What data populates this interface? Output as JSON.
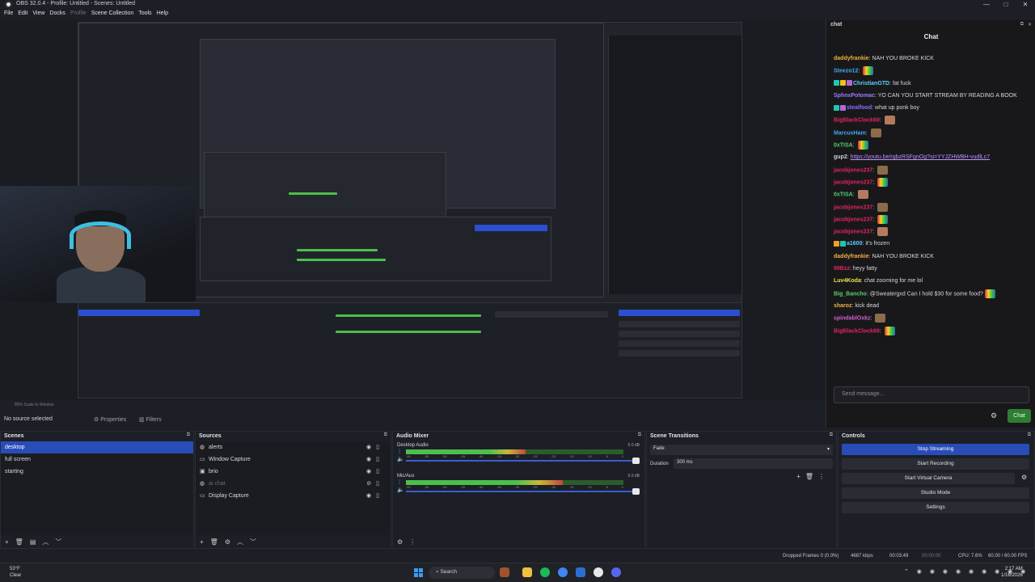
{
  "window": {
    "title": "OBS 32.0.4 - Profile: Untitled - Scenes: Untitled",
    "minimize": "—",
    "maximize": "□",
    "close": "✕"
  },
  "menu": [
    "File",
    "Edit",
    "View",
    "Docks",
    "Profile",
    "Scene Collection",
    "Tools",
    "Help"
  ],
  "preview_status": "85%     Scale to Window",
  "chat": {
    "dock_title": "chat",
    "header": "Chat",
    "input_placeholder": "Send message...",
    "send_label": "Chat",
    "messages": [
      {
        "user": "daddyfrankie",
        "text": "NAH YOU BROKE KICK",
        "color": "#f0b040"
      },
      {
        "user": "Steezo12",
        "text": "",
        "color": "#3fa9f5",
        "emote": true
      },
      {
        "user": "ChristianGTD",
        "text": "fat fuck",
        "color": "#5ad0ff",
        "badges": [
          "#1fc7b3",
          "#f0c020",
          "#b06ad8"
        ]
      },
      {
        "user": "SphnxPotomac",
        "text": "YO CAN YOU START STREAM BY READING A BOOK",
        "color": "#9b7bff"
      },
      {
        "user": "stealfood",
        "text": "what up ponk boy",
        "color": "#8f6cff",
        "badges": [
          "#1fc7b3",
          "#b06ad8"
        ]
      },
      {
        "user": "BigBlackClock69",
        "text": "",
        "color": "#e0245e",
        "emote": true
      },
      {
        "user": "MarcusHam",
        "text": "",
        "color": "#3fa9f5",
        "emote": true
      },
      {
        "user": "0xTISA",
        "text": "",
        "color": "#53d16f",
        "emote": true
      },
      {
        "user": "gup2",
        "text": "",
        "link": "https://youtu.be/rgbzRSFgnOg?si=YYJZHWBH-vudlLc7",
        "color": "#d0d0d6"
      },
      {
        "user": "jacobjones237",
        "text": "",
        "color": "#e0245e",
        "emote": true
      },
      {
        "user": "jacobjones237",
        "text": "",
        "color": "#e0245e",
        "emote": true
      },
      {
        "user": "0xTISA",
        "text": "",
        "color": "#53d16f",
        "emote": true
      },
      {
        "user": "jacobjones237",
        "text": "",
        "color": "#e0245e",
        "emote": true
      },
      {
        "user": "jacobjones237",
        "text": "",
        "color": "#e0245e",
        "emote": true
      },
      {
        "user": "jacobjones237",
        "text": "",
        "color": "#e0245e",
        "emote": true
      },
      {
        "user": "a1600",
        "text": "it's frozen",
        "color": "#5ad0ff",
        "badges": [
          "#f0a020",
          "#1fc7b3"
        ]
      },
      {
        "user": "daddyfrankie",
        "text": "NAH YOU BROKE KICK",
        "color": "#f0b040"
      },
      {
        "user": "99Bzz",
        "text": "heyy fatty",
        "color": "#e0245e"
      },
      {
        "user": "Luv4Koda",
        "text": "chat zooming for me lol",
        "color": "#f0e040"
      },
      {
        "user": "Big_Bancho",
        "text": "@Sweatergxd Can I hold $30 for some food?",
        "color": "#53d16f",
        "emote": true
      },
      {
        "user": "sharoz",
        "text": "kick dead",
        "color": "#f0b040"
      },
      {
        "user": "spindablOxkz",
        "text": "",
        "color": "#d05fd0",
        "emote": true
      },
      {
        "user": "BigBlackClock69",
        "text": "",
        "color": "#e0245e",
        "emote": true
      }
    ]
  },
  "source_toolbar": {
    "no_source": "No source selected",
    "properties": "Properties",
    "filters": "Filters"
  },
  "scenes": {
    "title": "Scenes",
    "items": [
      "desktop",
      "full screen",
      "starting"
    ],
    "selected_index": 0
  },
  "sources": {
    "title": "Sources",
    "items": [
      {
        "name": "alerts",
        "icon": "browser-icon"
      },
      {
        "name": "Window Capture",
        "icon": "window-icon"
      },
      {
        "name": "brio",
        "icon": "camera-icon"
      },
      {
        "name": "ai chat",
        "icon": "browser-icon",
        "hidden": true
      },
      {
        "name": "Display Capture",
        "icon": "monitor-icon"
      }
    ]
  },
  "mixer": {
    "title": "Audio Mixer",
    "channels": [
      {
        "name": "Desktop Audio",
        "db": "0.0 dB",
        "level": 0.55
      },
      {
        "name": "Mic/Aux",
        "db": "0.0 dB",
        "level": 0.72
      }
    ],
    "scale": [
      "-60",
      "-55",
      "-50",
      "-45",
      "-40",
      "-35",
      "-30",
      "-25",
      "-20",
      "-15",
      "-10",
      "-5",
      "0"
    ]
  },
  "transitions": {
    "title": "Scene Transitions",
    "selected": "Fade",
    "duration_label": "Duration",
    "duration_value": "300 ms"
  },
  "controls": {
    "title": "Controls",
    "buttons": [
      "Stop Streaming",
      "Start Recording",
      "Start Virtual Camera",
      "Studio Mode",
      "Settings"
    ]
  },
  "status": {
    "dropped": "Dropped Frames 0 (0.0%)",
    "bitrate": "4687 kbps",
    "stream_time": "00:03:49",
    "rec_time": "00:00:00",
    "cpu": "CPU: 7.6%",
    "fps": "60.00 / 60.00 FPS"
  },
  "taskbar": {
    "temp": "53°F",
    "weather": "Clear",
    "search": "Search",
    "time": "2:17 AM",
    "date": "1/16/2026"
  },
  "colors": {
    "accent": "#284cb8",
    "chat_send": "#2e7d32",
    "link": "#bf94ff"
  }
}
